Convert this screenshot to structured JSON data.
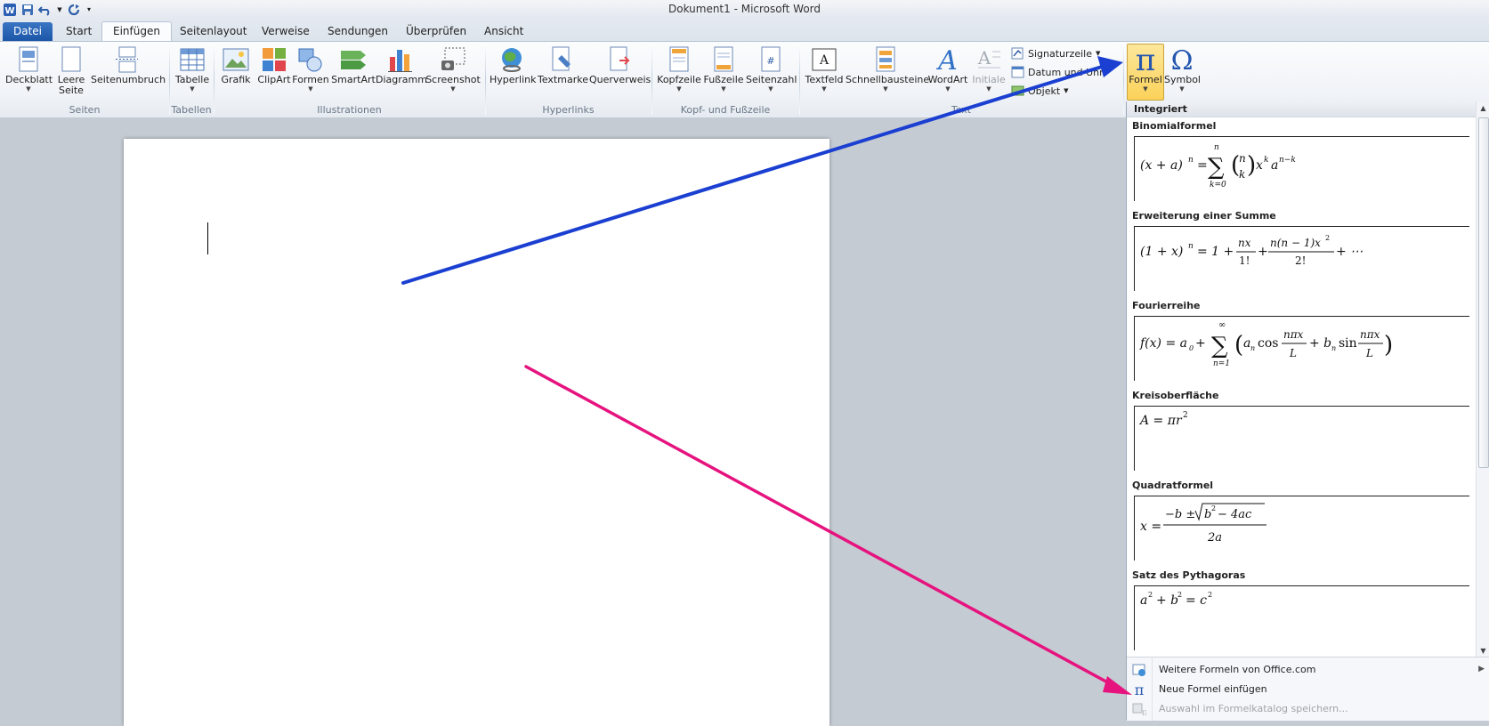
{
  "window": {
    "title": "Dokument1 - Microsoft Word"
  },
  "tabs": [
    {
      "label": "Datei"
    },
    {
      "label": "Start"
    },
    {
      "label": "Einfügen"
    },
    {
      "label": "Seitenlayout"
    },
    {
      "label": "Verweise"
    },
    {
      "label": "Sendungen"
    },
    {
      "label": "Überprüfen"
    },
    {
      "label": "Ansicht"
    }
  ],
  "ribbon": {
    "seiten": {
      "label": "Seiten",
      "deckblatt": "Deckblatt",
      "leere1": "Leere",
      "leere2": "Seite",
      "umbruch": "Seitenumbruch"
    },
    "tabellen": {
      "label": "Tabellen",
      "tabelle": "Tabelle"
    },
    "illustrationen": {
      "label": "Illustrationen",
      "grafik": "Grafik",
      "clipart": "ClipArt",
      "formen": "Formen",
      "smartart": "SmartArt",
      "diagramm": "Diagramm",
      "screenshot": "Screenshot"
    },
    "hyperlinks": {
      "label": "Hyperlinks",
      "hyperlink": "Hyperlink",
      "textmarke": "Textmarke",
      "querverweis": "Querverweis"
    },
    "kopf": {
      "label": "Kopf- und Fußzeile",
      "kopfzeile": "Kopfzeile",
      "fusszeile": "Fußzeile",
      "seitenzahl": "Seitenzahl"
    },
    "text": {
      "label": "Text",
      "textfeld": "Textfeld",
      "schnell": "Schnellbausteine",
      "wordart": "WordArt",
      "initiale": "Initiale",
      "signatur": "Signaturzeile",
      "datum": "Datum und Uhr",
      "objekt": "Objekt"
    },
    "symbole": {
      "formel": "Formel",
      "symbol": "Symbol"
    }
  },
  "gallery": {
    "header": "Integriert",
    "items": [
      {
        "title": "Binomialformel"
      },
      {
        "title": "Erweiterung einer Summe"
      },
      {
        "title": "Fourierreihe"
      },
      {
        "title": "Kreisoberfläche"
      },
      {
        "title": "Quadratformel"
      },
      {
        "title": "Satz des Pythagoras"
      }
    ],
    "menu": [
      {
        "label": "Weitere Formeln von Office.com"
      },
      {
        "label": "Neue Formel einfügen"
      },
      {
        "label": "Auswahl im Formelkatalog speichern..."
      }
    ]
  },
  "colors": {
    "accent_blue": "#1a3fd1",
    "accent_pink": "#e6137f",
    "file_tab": "#2a62b4",
    "highlight": "#fbd25a"
  }
}
